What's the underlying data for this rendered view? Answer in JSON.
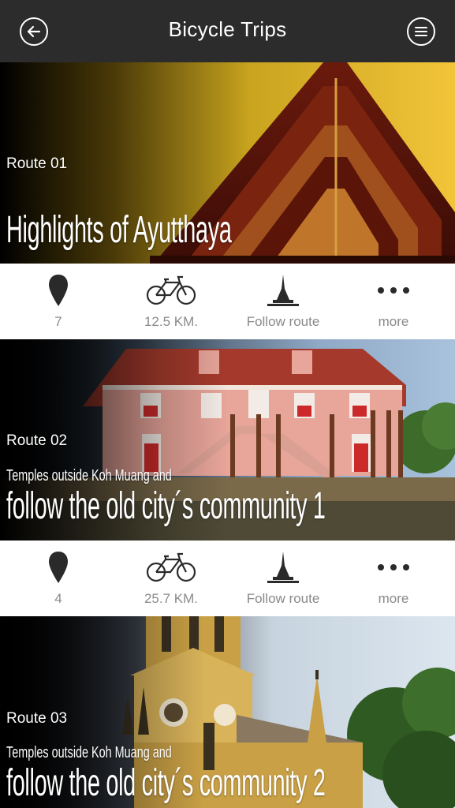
{
  "header": {
    "title": "Bicycle Trips",
    "back_icon": "back-arrow-icon",
    "menu_icon": "menu-icon"
  },
  "routes": [
    {
      "number": "Route 01",
      "subtitle": "",
      "title": "Highlights of Ayutthaya",
      "stats": {
        "pins": "7",
        "distance": "12.5 KM.",
        "follow": "Follow route",
        "more": "more"
      }
    },
    {
      "number": "Route 02",
      "subtitle": "Temples outside Koh Muang and",
      "title": "follow the old city´s community 1",
      "stats": {
        "pins": "4",
        "distance": "25.7 KM.",
        "follow": "Follow route",
        "more": "more"
      }
    },
    {
      "number": "Route 03",
      "subtitle": "Temples outside Koh Muang and",
      "title": "follow the old city´s community 2"
    }
  ],
  "colors": {
    "header_bg": "#2c2c2c",
    "label_gray": "#8a8a8a",
    "icon_dark": "#2a2a2a"
  }
}
